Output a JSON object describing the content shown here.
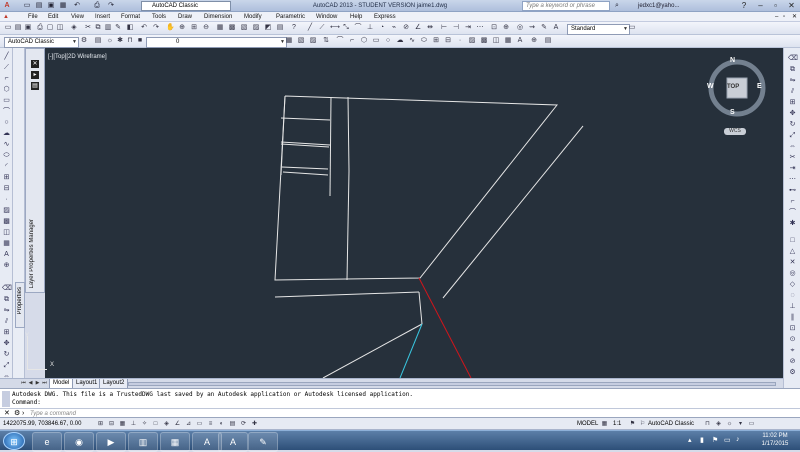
{
  "title_bar": {
    "workspace": "AutoCAD Classic",
    "app_title": "AutoCAD 2013 - STUDENT VERSION    jaime1.dwg",
    "search_placeholder": "Type a keyword or phrase",
    "user": "jedxc1@yaho..."
  },
  "menu": [
    "File",
    "Edit",
    "View",
    "Insert",
    "Format",
    "Tools",
    "Draw",
    "Dimension",
    "Modify",
    "Parametric",
    "Window",
    "Help",
    "Express"
  ],
  "toolbar2": {
    "workspace": "AutoCAD Classic",
    "layer": "0",
    "style": "Standard"
  },
  "palette": {
    "title": "Layer Properties Manager",
    "properties_tab": "Properties"
  },
  "viewport": {
    "label": "[-][Top][2D Wireframe]",
    "view_label": "TOP",
    "compass": {
      "n": "N",
      "s": "S",
      "e": "E",
      "w": "W"
    },
    "wcs": "WCS"
  },
  "layout_tabs": [
    "Model",
    "Layout1",
    "Layout2"
  ],
  "command": {
    "history_line1": "Autodesk DWG.  This file is a TrustedDWG last saved by an Autodesk application or Autodesk licensed application.",
    "history_line2": "Command:",
    "placeholder": "Type a command"
  },
  "status": {
    "coordinates": "1422075.99, 703846.67, 0.00",
    "model": "MODEL",
    "scale": "1:1",
    "workspace": "AutoCAD Classic"
  },
  "clock": {
    "time": "11:02 PM",
    "date": "1/17/2015"
  },
  "colors": {
    "canvas": "#26303b",
    "line_white": "#e6e6e6",
    "line_red": "#d0151b",
    "line_cyan": "#39c6e0"
  }
}
